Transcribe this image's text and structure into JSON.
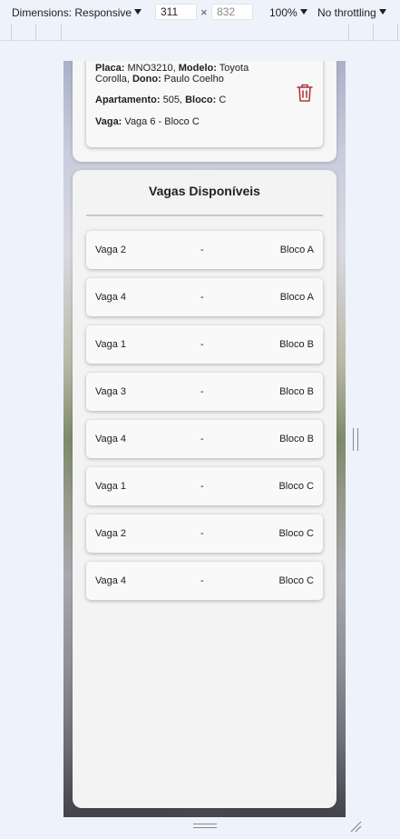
{
  "devtools": {
    "dimensions_label": "Dimensions: Responsive",
    "width_value": "311",
    "times_sign": "×",
    "height_value": "832",
    "zoom": "100%",
    "throttling": "No throttling"
  },
  "vehicle_card": {
    "placa_label": "Placa:",
    "placa_value": "MNO3210,",
    "modelo_label": "Modelo:",
    "modelo_value": "Toyota",
    "modelo_value_cont": "Corolla,",
    "dono_label": "Dono:",
    "dono_value": "Paulo Coelho",
    "apto_label": "Apartamento:",
    "apto_value": "505,",
    "bloco_label": "Bloco:",
    "bloco_value": "C",
    "vaga_label": "Vaga:",
    "vaga_value": "Vaga 6 - Bloco C",
    "delete_icon": "trash-icon",
    "accent_color": "#b3363c"
  },
  "available": {
    "title": "Vagas Disponíveis",
    "spots": [
      {
        "name": "Vaga 2",
        "sep": "-",
        "block": "Bloco A"
      },
      {
        "name": "Vaga 4",
        "sep": "-",
        "block": "Bloco A"
      },
      {
        "name": "Vaga 1",
        "sep": "-",
        "block": "Bloco B"
      },
      {
        "name": "Vaga 3",
        "sep": "-",
        "block": "Bloco B"
      },
      {
        "name": "Vaga 4",
        "sep": "-",
        "block": "Bloco B"
      },
      {
        "name": "Vaga 1",
        "sep": "-",
        "block": "Bloco C"
      },
      {
        "name": "Vaga 2",
        "sep": "-",
        "block": "Bloco C"
      },
      {
        "name": "Vaga 4",
        "sep": "-",
        "block": "Bloco C"
      }
    ]
  }
}
